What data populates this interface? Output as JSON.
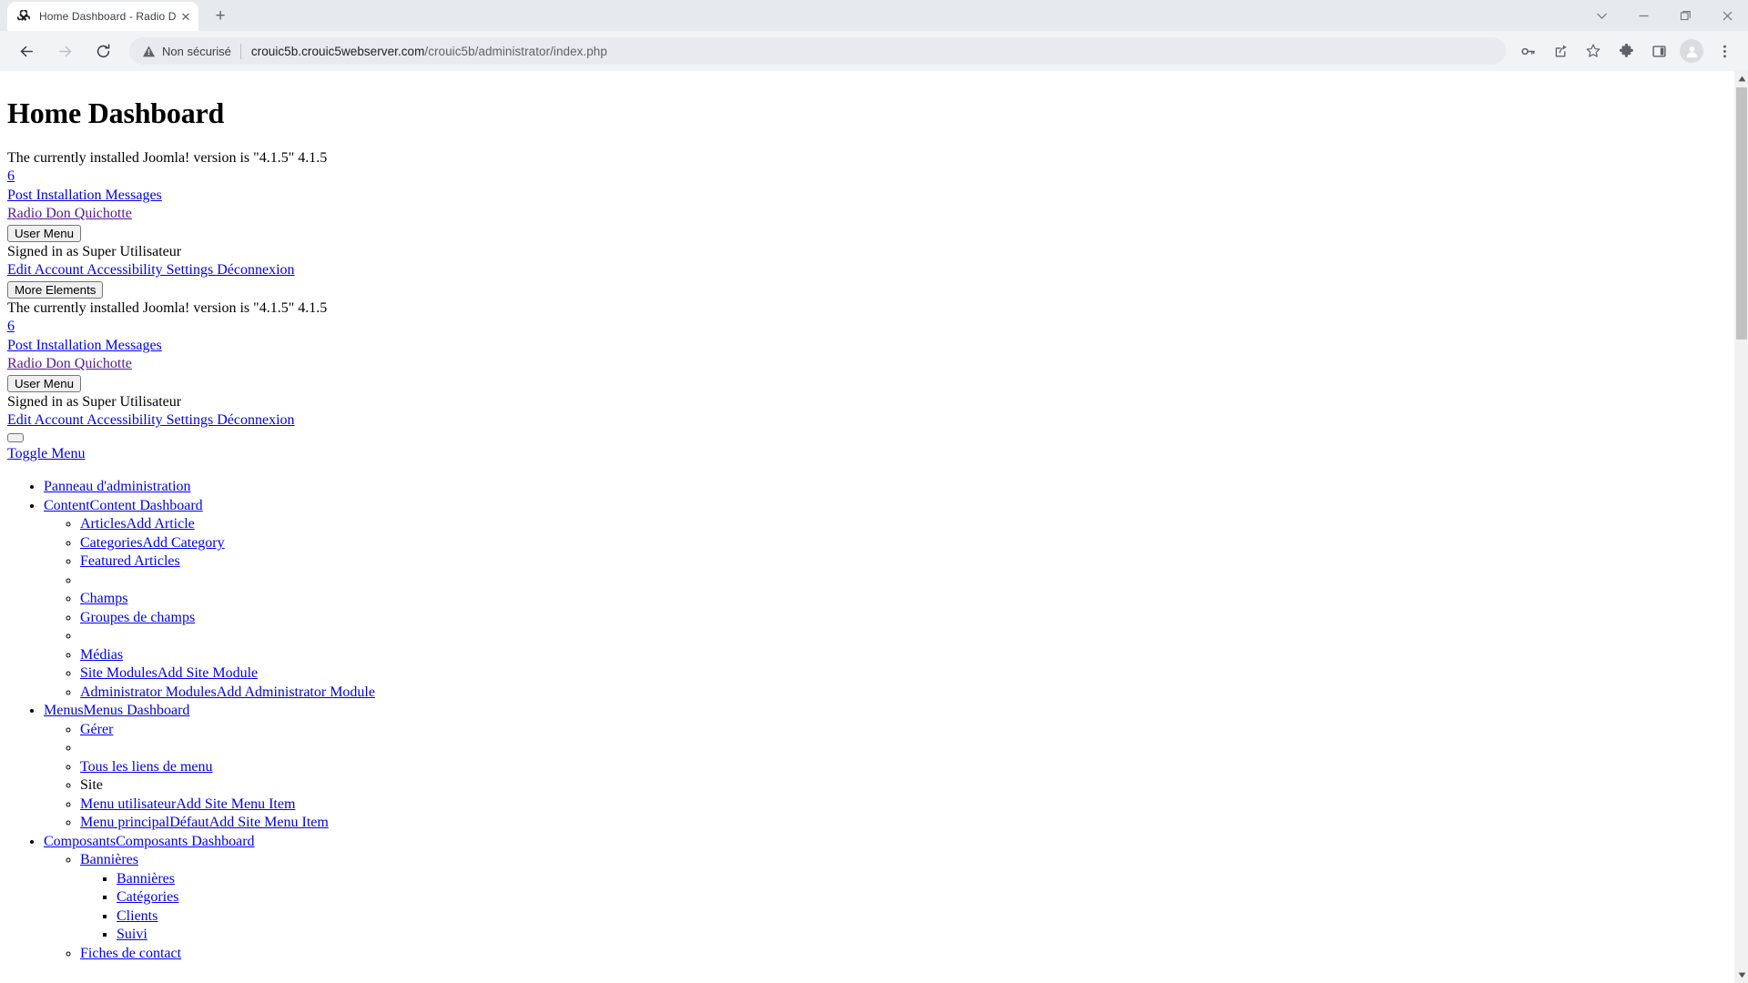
{
  "browser": {
    "tab": {
      "title": "Home Dashboard - Radio Don Quichotte",
      "favicon_name": "joomla-favicon",
      "close_glyph": "✕"
    },
    "newtab_glyph": "+",
    "window_controls": [
      {
        "name": "tab-search-button",
        "glyph": "⌄"
      },
      {
        "name": "minimize-button",
        "glyph": "—"
      },
      {
        "name": "maximize-button",
        "glyph": "❐"
      },
      {
        "name": "close-window-button",
        "glyph": "✕"
      }
    ],
    "nav": {
      "back_glyph": "←",
      "forward_glyph": "→",
      "reload_glyph": "↻"
    },
    "omnibox": {
      "security_label": "Non sécurisé",
      "security_icon": "warning-triangle-icon",
      "url_domain": "crouic5b.crouic5webserver.com",
      "url_path": "/crouic5b/administrator/index.php"
    },
    "toolbar_icons": [
      {
        "name": "password-key-icon",
        "glyph": "⚷"
      },
      {
        "name": "share-icon",
        "glyph": "⤴"
      },
      {
        "name": "bookmark-star-icon",
        "glyph": "☆"
      },
      {
        "name": "extensions-puzzle-icon",
        "glyph": "❖"
      },
      {
        "name": "side-panel-icon",
        "glyph": "▢"
      },
      {
        "name": "profile-avatar",
        "glyph": "●"
      },
      {
        "name": "browser-menu-icon",
        "glyph": "⋮"
      }
    ]
  },
  "page": {
    "heading": "Home Dashboard",
    "status_blocks": [
      {
        "version_text": "The currently installed Joomla! version is \"4.1.5\" 4.1.5",
        "count_link": "6",
        "post_install_link": "Post Installation Messages",
        "site_link": "Radio Don Quichotte",
        "user_menu_button": "User Menu",
        "signed_in_text": "Signed in as Super Utilisateur",
        "account_links": "Edit Account Accessibility Settings Déconnexion",
        "more_elements_button": "More Elements"
      },
      {
        "version_text": "The currently installed Joomla! version is \"4.1.5\" 4.1.5",
        "count_link": "6",
        "post_install_link": "Post Installation Messages",
        "site_link": "Radio Don Quichotte",
        "user_menu_button": "User Menu",
        "signed_in_text": "Signed in as Super Utilisateur",
        "account_links": "Edit Account Accessibility Settings Déconnexion"
      }
    ],
    "toggle_menu_link": "Toggle Menu",
    "menu": [
      {
        "label": "Panneau d'administration",
        "link": true,
        "children": []
      },
      {
        "label": "ContentContent Dashboard",
        "link": true,
        "children": [
          {
            "label": "ArticlesAdd Article",
            "link": true
          },
          {
            "label": "CategoriesAdd Category",
            "link": true
          },
          {
            "label": "Featured Articles",
            "link": true
          },
          {
            "label": "",
            "link": false
          },
          {
            "label": "Champs",
            "link": true
          },
          {
            "label": "Groupes de champs",
            "link": true
          },
          {
            "label": "",
            "link": false
          },
          {
            "label": "Médias",
            "link": true
          },
          {
            "label": "Site ModulesAdd Site Module",
            "link": true
          },
          {
            "label": "Administrator ModulesAdd Administrator Module",
            "link": true
          }
        ]
      },
      {
        "label": "MenusMenus Dashboard",
        "link": true,
        "children": [
          {
            "label": "Gérer",
            "link": true
          },
          {
            "label": "",
            "link": false
          },
          {
            "label": "Tous les liens de menu",
            "link": true
          },
          {
            "label": "Site",
            "link": false
          },
          {
            "label": "Menu utilisateurAdd Site Menu Item",
            "link": true
          },
          {
            "label": "Menu principalDéfautAdd Site Menu Item",
            "link": true
          }
        ]
      },
      {
        "label": "ComposantsComposants Dashboard",
        "link": true,
        "children": [
          {
            "label": "Bannières",
            "link": true,
            "children": [
              {
                "label": "Bannières",
                "link": true
              },
              {
                "label": "Catégories",
                "link": true
              },
              {
                "label": "Clients",
                "link": true
              },
              {
                "label": "Suivi",
                "link": true
              }
            ]
          },
          {
            "label": "Fiches de contact",
            "link": true
          }
        ]
      }
    ]
  },
  "scrollbar": {
    "up_glyph": "▲",
    "down_glyph": "▼"
  }
}
